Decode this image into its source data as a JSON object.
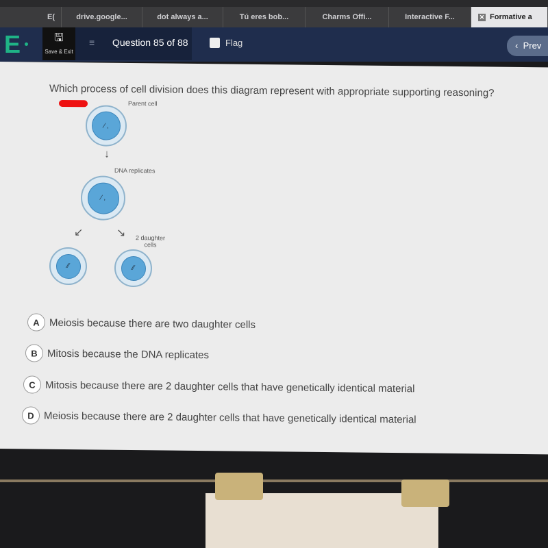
{
  "tabs": [
    {
      "label": "E("
    },
    {
      "label": "drive.google..."
    },
    {
      "label": "dot always a..."
    },
    {
      "label": "Tú eres bob..."
    },
    {
      "label": "Charms Offi..."
    },
    {
      "label": "Interactive F..."
    },
    {
      "label": "Formative a",
      "active": true
    }
  ],
  "header": {
    "logo": "E",
    "save_label": "Save & Exit",
    "question_label": "Question 85 of 88",
    "flag_label": "Flag",
    "prev_label": "Prev"
  },
  "question": {
    "text": "Which process of cell division does this diagram represent with appropriate supporting reasoning?",
    "diagram": {
      "parent": "Parent cell",
      "step": "DNA replicates",
      "daughter_line1": "2 daughter",
      "daughter_line2": "cells"
    }
  },
  "choices": [
    {
      "letter": "A",
      "text": "Meiosis because there are two daughter cells"
    },
    {
      "letter": "B",
      "text": "Mitosis because the DNA replicates"
    },
    {
      "letter": "C",
      "text": "Mitosis because there are 2 daughter cells that have genetically identical material"
    },
    {
      "letter": "D",
      "text": "Meiosis because there are 2 daughter cells that have genetically identical material"
    }
  ],
  "colors": {
    "header": "#1f2d4d",
    "logo": "#1fb386",
    "cell": "#5aa6d8"
  }
}
